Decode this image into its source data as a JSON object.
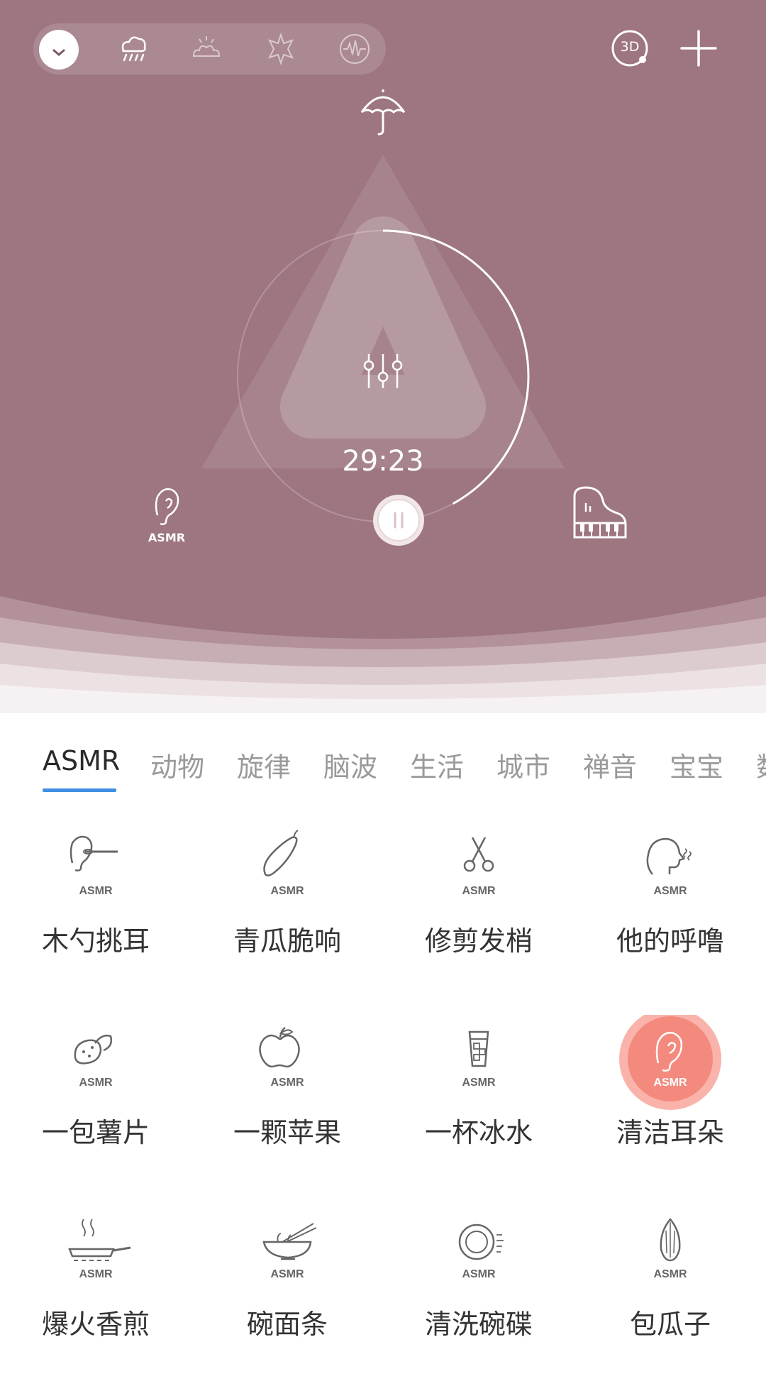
{
  "app": {
    "colors": {
      "hero_bg": "#9e7680",
      "accent_tab": "#3f8fe3",
      "selected_item": "#f48a7d",
      "selected_halo": "#f9b3ab",
      "text_primary": "#333333",
      "text_muted": "#9a9a9a"
    }
  },
  "header": {
    "modes": [
      {
        "icon": "chevron-down-icon",
        "active": true
      },
      {
        "icon": "rain-cloud-icon",
        "active": false
      },
      {
        "icon": "sunrise-icon",
        "active": false
      },
      {
        "icon": "sun-icon",
        "active": false
      },
      {
        "icon": "brainwave-icon",
        "active": false
      }
    ],
    "badge_3d": "3D",
    "add_icon": "plus-icon"
  },
  "player": {
    "top_icon": "umbrella-icon",
    "center_icon": "mixer-icon",
    "timer": "29:23",
    "progress": 0.42,
    "left_sound": {
      "icon": "ear-icon",
      "label": "ASMR"
    },
    "right_sound": {
      "icon": "piano-icon"
    },
    "state": "playing"
  },
  "tabs": {
    "items": [
      "ASMR",
      "动物",
      "旋律",
      "脑波",
      "生活",
      "城市",
      "禅音",
      "宝宝",
      "数"
    ],
    "active_index": 0
  },
  "sounds": {
    "items": [
      {
        "label": "木勺挑耳",
        "icon": "ear-pick-icon",
        "tag": "ASMR",
        "selected": false
      },
      {
        "label": "青瓜脆响",
        "icon": "cucumber-icon",
        "tag": "ASMR",
        "selected": false
      },
      {
        "label": "修剪发梢",
        "icon": "scissors-icon",
        "tag": "ASMR",
        "selected": false
      },
      {
        "label": "他的呼噜",
        "icon": "snoring-head-icon",
        "tag": "ASMR",
        "selected": false
      },
      {
        "label": "一包薯片",
        "icon": "potato-chips-icon",
        "tag": "ASMR",
        "selected": false
      },
      {
        "label": "一颗苹果",
        "icon": "apple-icon",
        "tag": "ASMR",
        "selected": false
      },
      {
        "label": "一杯冰水",
        "icon": "ice-water-icon",
        "tag": "ASMR",
        "selected": false
      },
      {
        "label": "清洁耳朵",
        "icon": "ear-icon",
        "tag": "ASMR",
        "selected": true
      },
      {
        "label": "爆火香煎",
        "icon": "frying-pan-icon",
        "tag": "ASMR",
        "selected": false
      },
      {
        "label": "碗面条",
        "icon": "noodle-bowl-icon",
        "tag": "ASMR",
        "selected": false
      },
      {
        "label": "清洗碗碟",
        "icon": "plate-icon",
        "tag": "ASMR",
        "selected": false
      },
      {
        "label": "包瓜子",
        "icon": "sunflower-seed-icon",
        "tag": "ASMR",
        "selected": false
      }
    ]
  }
}
